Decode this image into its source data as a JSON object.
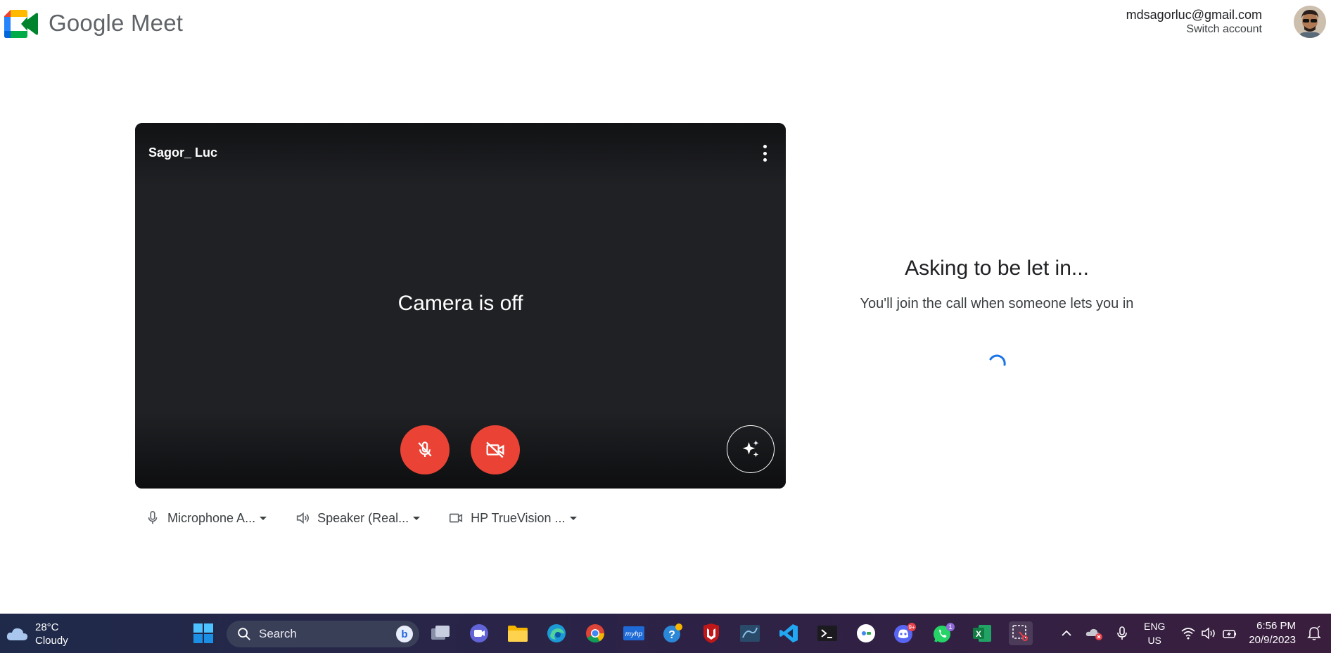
{
  "header": {
    "brand": "Google Meet",
    "email": "mdsagorluc@gmail.com",
    "switch_account": "Switch account"
  },
  "preview": {
    "participant_name": "Sagor_ Luc",
    "camera_status": "Camera is off",
    "mic_state": "muted",
    "camera_state": "off"
  },
  "devices": {
    "microphone": "Microphone A...",
    "speaker": "Speaker (Real...",
    "camera": "HP TrueVision ..."
  },
  "join": {
    "title": "Asking to be let in...",
    "subtitle": "You'll join the call when someone lets you in"
  },
  "taskbar": {
    "temperature": "28°C",
    "condition": "Cloudy",
    "search_label": "Search",
    "discord_badge": "9+",
    "whatsapp_badge": "1",
    "lang_line1": "ENG",
    "lang_line2": "US",
    "time": "6:56 PM",
    "date": "20/9/2023"
  },
  "colors": {
    "red_button": "#ea4335",
    "preview_bg": "#202124",
    "spinner": "#1a73e8"
  }
}
